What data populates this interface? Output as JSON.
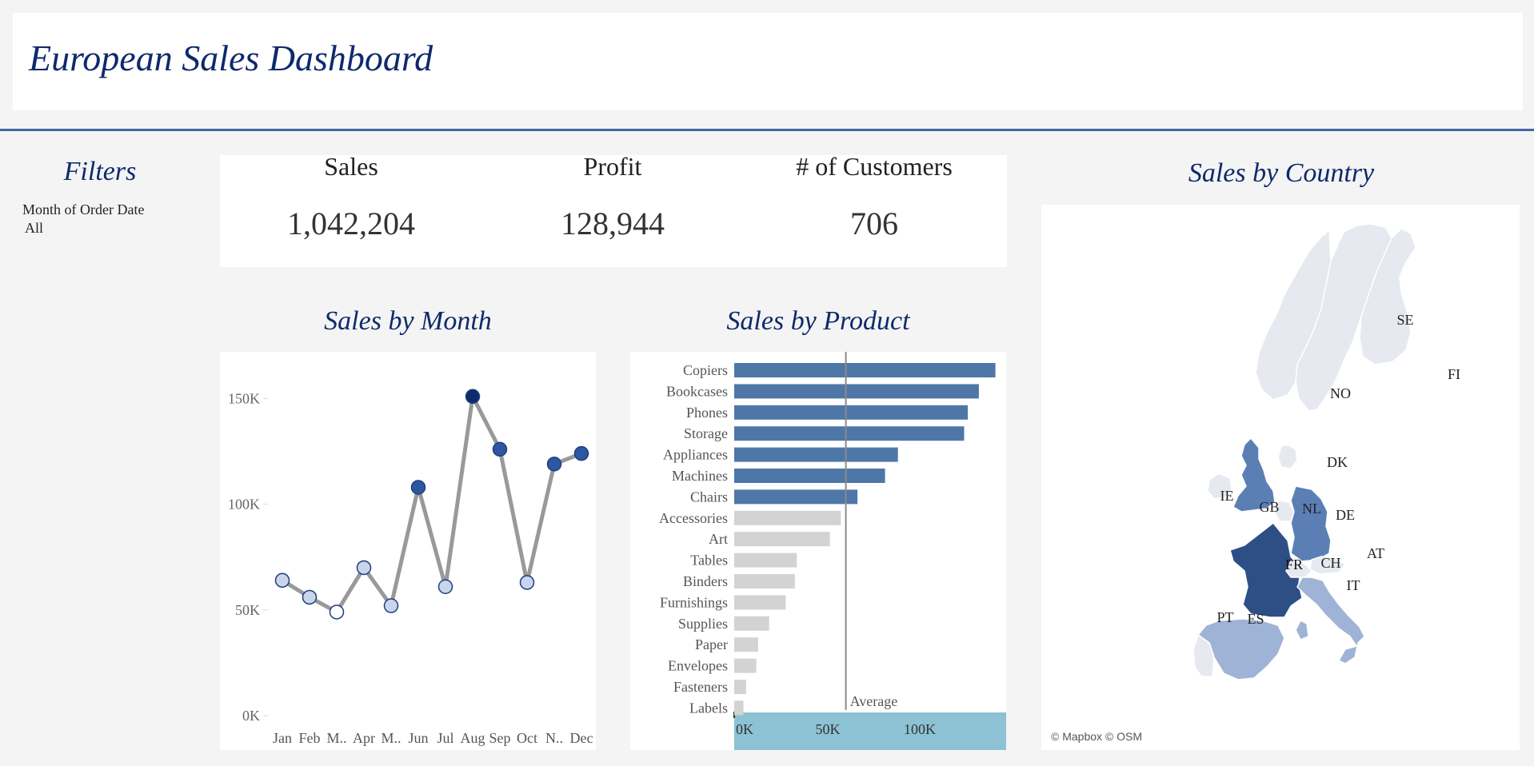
{
  "header": {
    "title": "European Sales Dashboard"
  },
  "filters": {
    "title": "Filters",
    "label": "Month of Order Date",
    "value": "All"
  },
  "kpis": [
    {
      "label": "Sales",
      "value": "1,042,204"
    },
    {
      "label": "Profit",
      "value": "128,944"
    },
    {
      "label": "# of Customers",
      "value": "706"
    }
  ],
  "sections": {
    "month_title": "Sales by Month",
    "product_title": "Sales by Product",
    "country_title": "Sales by Country"
  },
  "map": {
    "credit": "© Mapbox © OSM",
    "countries": [
      {
        "code": "SE",
        "level": "low"
      },
      {
        "code": "FI",
        "level": "low"
      },
      {
        "code": "NO",
        "level": "low"
      },
      {
        "code": "DK",
        "level": "low"
      },
      {
        "code": "IE",
        "level": "low"
      },
      {
        "code": "GB",
        "level": "mid"
      },
      {
        "code": "NL",
        "level": "low"
      },
      {
        "code": "DE",
        "level": "mid"
      },
      {
        "code": "FR",
        "level": "high"
      },
      {
        "code": "CH",
        "level": "low"
      },
      {
        "code": "AT",
        "level": "low"
      },
      {
        "code": "IT",
        "level": "low-mid"
      },
      {
        "code": "PT",
        "level": "low"
      },
      {
        "code": "ES",
        "level": "low-mid"
      }
    ],
    "colors": {
      "low": "#e6e9f0",
      "low-mid": "#9fb3d6",
      "mid": "#5b7fb5",
      "high": "#2d4f86"
    }
  },
  "chart_data": [
    {
      "type": "line",
      "title": "Sales by Month",
      "categories": [
        "Jan",
        "Feb",
        "M..",
        "Apr",
        "M..",
        "Jun",
        "Jul",
        "Aug",
        "Sep",
        "Oct",
        "N..",
        "Dec"
      ],
      "values": [
        64000,
        56000,
        49000,
        70000,
        52000,
        108000,
        61000,
        151000,
        126000,
        63000,
        119000,
        124000
      ],
      "ylim": [
        0,
        160000
      ],
      "yticks": [
        0,
        50000,
        100000,
        150000
      ],
      "ytick_labels": [
        "0K",
        "50K",
        "100K",
        "150K"
      ],
      "colors": {
        "line": "#999999",
        "low": "#c9d5ea",
        "mid": "#2f56a0",
        "high": "#0d2a6b"
      }
    },
    {
      "type": "bar",
      "orientation": "horizontal",
      "title": "Sales by Product",
      "categories": [
        "Copiers",
        "Bookcases",
        "Phones",
        "Storage",
        "Appliances",
        "Machines",
        "Chairs",
        "Accessories",
        "Art",
        "Tables",
        "Binders",
        "Furnishings",
        "Supplies",
        "Paper",
        "Envelopes",
        "Fasteners",
        "Labels"
      ],
      "values": [
        142000,
        133000,
        127000,
        125000,
        89000,
        82000,
        67000,
        58000,
        52000,
        34000,
        33000,
        28000,
        19000,
        13000,
        12000,
        6500,
        5000
      ],
      "average": 60700,
      "average_label": "Average",
      "xlim": [
        0,
        150000
      ],
      "xticks": [
        0,
        50000,
        100000
      ],
      "xtick_labels": [
        "0K",
        "50K",
        "100K"
      ],
      "colors": {
        "above_avg": "#4e77a8",
        "below_avg": "#d3d3d3",
        "axis_band": "#8cc2d4",
        "avg_line": "#8a8a8a"
      }
    }
  ]
}
